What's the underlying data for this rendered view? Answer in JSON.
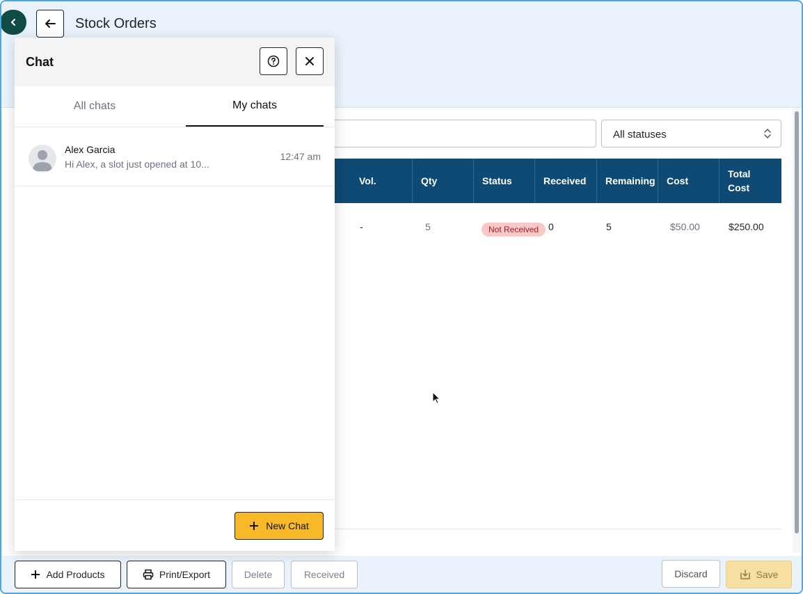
{
  "header": {
    "title": "Stock Orders"
  },
  "filters": {
    "status_value": "All statuses"
  },
  "table": {
    "columns": [
      "Vol.",
      "Qty",
      "Status",
      "Received",
      "Remaining",
      "Cost",
      "Total Cost"
    ],
    "rows": [
      {
        "vol": "-",
        "qty": "5",
        "status": "Not Received",
        "received": "0",
        "remaining": "5",
        "cost": "$50.00",
        "total_cost": "$250.00"
      }
    ]
  },
  "footer": {
    "add_products": "Add Products",
    "print_export": "Print/Export",
    "delete": "Delete",
    "received": "Received",
    "discard": "Discard",
    "save": "Save"
  },
  "chat": {
    "title": "Chat",
    "tabs": [
      "All chats",
      "My chats"
    ],
    "active_tab": "My chats",
    "items": [
      {
        "name": "Alex Garcia",
        "preview": "Hi Alex, a slot just opened at 10...",
        "time": "12:47 am"
      }
    ],
    "new_chat_label": "New Chat"
  },
  "colors": {
    "table_header": "#0e4a73",
    "new_chat_button": "#f7b928",
    "status_badge_bg": "#f9c9c9",
    "sidebar_toggle": "#0f4c45"
  }
}
